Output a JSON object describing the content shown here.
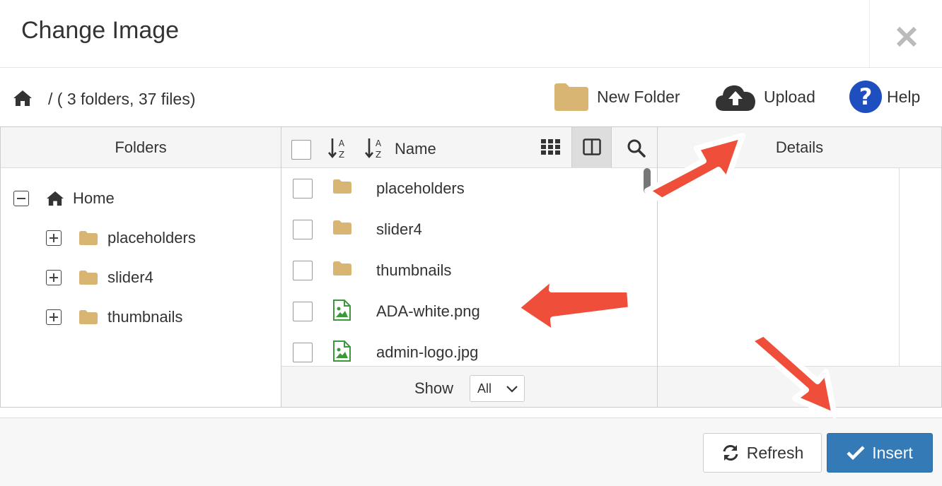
{
  "dialog": {
    "title": "Change Image"
  },
  "toolbar": {
    "path": "/ ( 3 folders, 37 files)",
    "new_folder": "New Folder",
    "upload": "Upload",
    "help": "Help"
  },
  "folders_panel": {
    "header": "Folders",
    "root": "Home",
    "children": [
      "placeholders",
      "slider4",
      "thumbnails"
    ]
  },
  "files_panel": {
    "sort_label": "Name",
    "files": [
      {
        "name": "placeholders",
        "type": "folder"
      },
      {
        "name": "slider4",
        "type": "folder"
      },
      {
        "name": "thumbnails",
        "type": "folder"
      },
      {
        "name": "ADA-white.png",
        "type": "image"
      },
      {
        "name": "admin-logo.jpg",
        "type": "image"
      }
    ],
    "show_label": "Show",
    "show_value": "All"
  },
  "details_panel": {
    "header": "Details"
  },
  "footer": {
    "refresh": "Refresh",
    "insert": "Insert"
  },
  "colors": {
    "folder": "#d9b574",
    "primary": "#337ab7",
    "help": "#1f4fbf",
    "image_icon": "#3a9a3a",
    "annotation_arrow": "#ee4e3a"
  }
}
